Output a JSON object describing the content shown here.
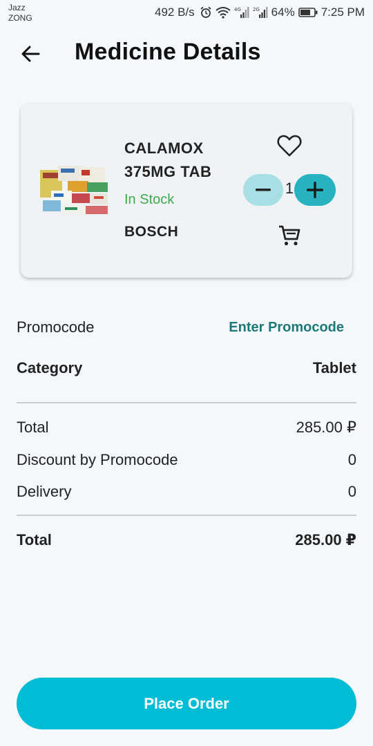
{
  "status_bar": {
    "carrier_1": "Jazz",
    "carrier_2": "ZONG",
    "net_speed": "492 B/s",
    "battery": "64%",
    "time": "7:25 PM"
  },
  "header": {
    "title": "Medicine Details"
  },
  "product": {
    "name_line_1": "CALAMOX",
    "name_line_2": "375MG TAB",
    "stock": "In Stock",
    "brand": "BOSCH",
    "quantity": "1"
  },
  "promo": {
    "label": "Promocode",
    "action": "Enter Promocode"
  },
  "category": {
    "label": "Category",
    "value": "Tablet"
  },
  "summary": {
    "total_label": "Total",
    "total_value": "285.00 ₽",
    "discount_label": "Discount by Promocode",
    "discount_value": "0",
    "delivery_label": "Delivery",
    "delivery_value": "0",
    "grand_total_label": "Total",
    "grand_total_value": "285.00 ₽"
  },
  "actions": {
    "place_order": "Place Order"
  },
  "colors": {
    "accent": "#00bcd4",
    "stepper_plus": "#26b3bf",
    "stepper_minus": "#a8dfe4",
    "in_stock": "#3faa4a",
    "link": "#1d7878"
  },
  "icons": [
    "back-arrow-icon",
    "heart-icon",
    "minus-icon",
    "plus-icon",
    "cart-icon",
    "alarm-icon",
    "wifi-icon",
    "signal-icon",
    "battery-icon"
  ]
}
